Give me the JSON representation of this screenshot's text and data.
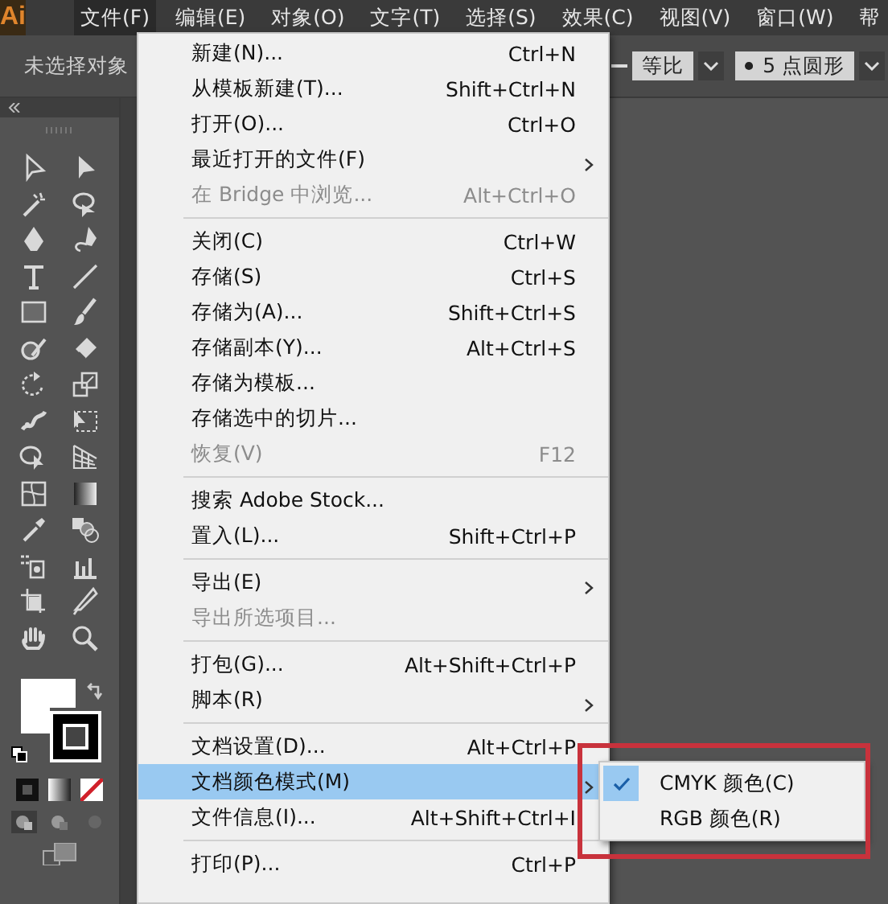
{
  "menu_bar": {
    "logo": "Ai",
    "menus": [
      {
        "label": "文件(F)",
        "selected": true
      },
      {
        "label": "编辑(E)",
        "selected": false
      },
      {
        "label": "对象(O)",
        "selected": false
      },
      {
        "label": "文字(T)",
        "selected": false
      },
      {
        "label": "选择(S)",
        "selected": false
      },
      {
        "label": "效果(C)",
        "selected": false
      },
      {
        "label": "视图(V)",
        "selected": false
      },
      {
        "label": "窗口(W)",
        "selected": false
      },
      {
        "label": "帮",
        "selected": false
      }
    ]
  },
  "control_bar": {
    "selection_status": "未选择对象",
    "width_profile": "等比",
    "brush": "5 点圆形"
  },
  "file_menu": {
    "items": [
      {
        "kind": "item",
        "label": "新建(N)...",
        "shortcut": "Ctrl+N",
        "submenu": false,
        "disabled": false,
        "selected": false
      },
      {
        "kind": "item",
        "label": "从模板新建(T)...",
        "shortcut": "Shift+Ctrl+N",
        "submenu": false,
        "disabled": false,
        "selected": false
      },
      {
        "kind": "item",
        "label": "打开(O)...",
        "shortcut": "Ctrl+O",
        "submenu": false,
        "disabled": false,
        "selected": false
      },
      {
        "kind": "item",
        "label": "最近打开的文件(F)",
        "submenu": true,
        "disabled": false,
        "selected": false
      },
      {
        "kind": "item",
        "label": "在 Bridge 中浏览...",
        "shortcut": "Alt+Ctrl+O",
        "submenu": false,
        "disabled": true,
        "selected": false
      },
      {
        "kind": "separator"
      },
      {
        "kind": "item",
        "label": "关闭(C)",
        "shortcut": "Ctrl+W",
        "submenu": false,
        "disabled": false,
        "selected": false
      },
      {
        "kind": "item",
        "label": "存储(S)",
        "shortcut": "Ctrl+S",
        "submenu": false,
        "disabled": false,
        "selected": false
      },
      {
        "kind": "item",
        "label": "存储为(A)...",
        "shortcut": "Shift+Ctrl+S",
        "submenu": false,
        "disabled": false,
        "selected": false
      },
      {
        "kind": "item",
        "label": "存储副本(Y)...",
        "shortcut": "Alt+Ctrl+S",
        "submenu": false,
        "disabled": false,
        "selected": false
      },
      {
        "kind": "item",
        "label": "存储为模板...",
        "submenu": false,
        "disabled": false,
        "selected": false
      },
      {
        "kind": "item",
        "label": "存储选中的切片...",
        "submenu": false,
        "disabled": false,
        "selected": false
      },
      {
        "kind": "item",
        "label": "恢复(V)",
        "shortcut": "F12",
        "submenu": false,
        "disabled": true,
        "selected": false
      },
      {
        "kind": "separator"
      },
      {
        "kind": "item",
        "label": "搜索 Adobe Stock...",
        "submenu": false,
        "disabled": false,
        "selected": false
      },
      {
        "kind": "item",
        "label": "置入(L)...",
        "shortcut": "Shift+Ctrl+P",
        "submenu": false,
        "disabled": false,
        "selected": false
      },
      {
        "kind": "separator"
      },
      {
        "kind": "item",
        "label": "导出(E)",
        "submenu": true,
        "disabled": false,
        "selected": false
      },
      {
        "kind": "item",
        "label": "导出所选项目...",
        "submenu": false,
        "disabled": true,
        "selected": false
      },
      {
        "kind": "separator"
      },
      {
        "kind": "item",
        "label": "打包(G)...",
        "shortcut": "Alt+Shift+Ctrl+P",
        "submenu": false,
        "disabled": false,
        "selected": false
      },
      {
        "kind": "item",
        "label": "脚本(R)",
        "submenu": true,
        "disabled": false,
        "selected": false
      },
      {
        "kind": "separator"
      },
      {
        "kind": "item",
        "label": "文档设置(D)...",
        "shortcut": "Alt+Ctrl+P",
        "submenu": false,
        "disabled": false,
        "selected": false
      },
      {
        "kind": "item",
        "label": "文档颜色模式(M)",
        "submenu": true,
        "disabled": false,
        "selected": true
      },
      {
        "kind": "item",
        "label": "文件信息(I)...",
        "shortcut": "Alt+Shift+Ctrl+I",
        "submenu": false,
        "disabled": false,
        "selected": false
      },
      {
        "kind": "separator"
      },
      {
        "kind": "item",
        "label": "打印(P)...",
        "shortcut": "Ctrl+P",
        "submenu": false,
        "disabled": false,
        "selected": false
      }
    ]
  },
  "color_mode_submenu": {
    "items": [
      {
        "label": "CMYK 颜色(C)",
        "checked": true
      },
      {
        "label": "RGB 颜色(R)",
        "checked": false
      }
    ]
  }
}
